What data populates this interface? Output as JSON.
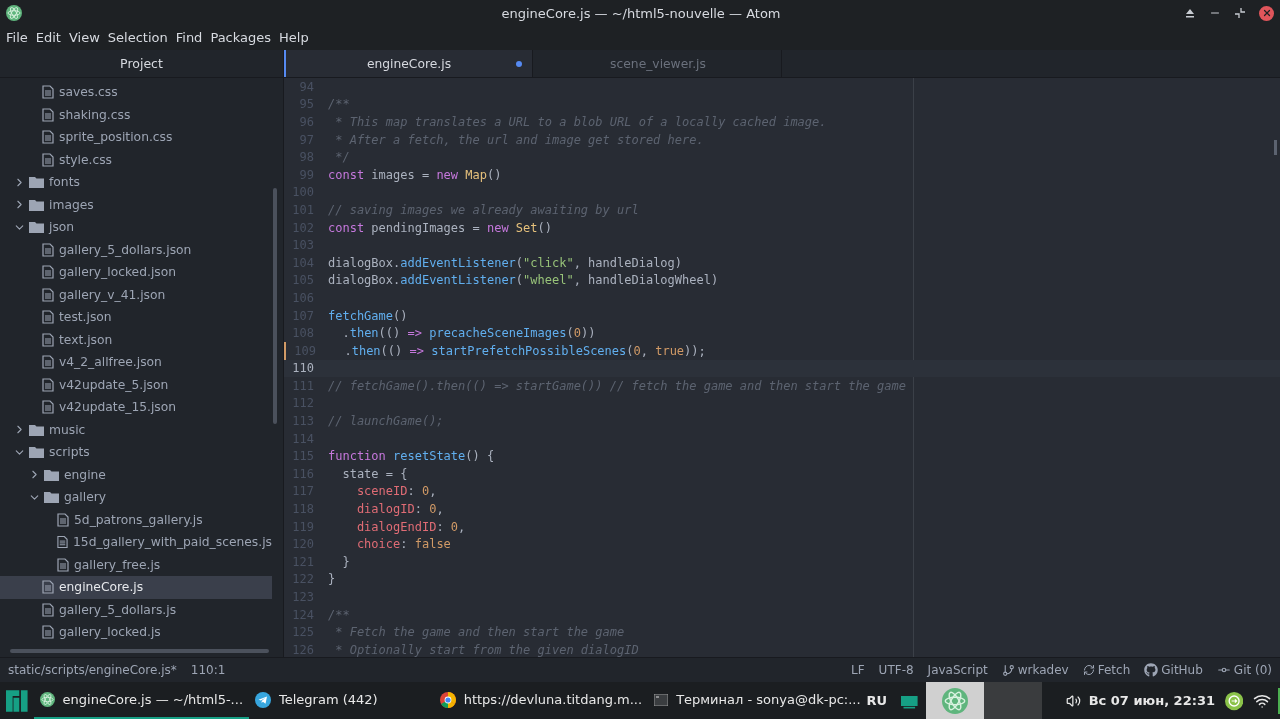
{
  "window": {
    "title": "engineCore.js — ~/html5-nouvelle — Atom"
  },
  "menu": [
    "File",
    "Edit",
    "View",
    "Selection",
    "Find",
    "Packages",
    "Help"
  ],
  "sidebar": {
    "title": "Project",
    "tree": [
      {
        "kind": "group",
        "children": [
          {
            "kind": "file",
            "label": "saves.css",
            "selected": false
          },
          {
            "kind": "file",
            "label": "shaking.css",
            "selected": false
          },
          {
            "kind": "file",
            "label": "sprite_position.css",
            "selected": false
          },
          {
            "kind": "file",
            "label": "style.css",
            "selected": false
          }
        ]
      },
      {
        "kind": "folder",
        "label": "fonts",
        "expanded": false,
        "selected": false
      },
      {
        "kind": "folder",
        "label": "images",
        "expanded": false,
        "selected": false
      },
      {
        "kind": "folder",
        "label": "json",
        "expanded": true,
        "selected": false,
        "children": [
          {
            "kind": "file",
            "label": "gallery_5_dollars.json",
            "selected": false
          },
          {
            "kind": "file",
            "label": "gallery_locked.json",
            "selected": false
          },
          {
            "kind": "file",
            "label": "gallery_v_41.json",
            "selected": false
          },
          {
            "kind": "file",
            "label": "test.json",
            "selected": false
          },
          {
            "kind": "file",
            "label": "text.json",
            "selected": false
          },
          {
            "kind": "file",
            "label": "v4_2_allfree.json",
            "selected": false
          },
          {
            "kind": "file",
            "label": "v42update_5.json",
            "selected": false
          },
          {
            "kind": "file",
            "label": "v42update_15.json",
            "selected": false
          }
        ]
      },
      {
        "kind": "folder",
        "label": "music",
        "expanded": false,
        "selected": false
      },
      {
        "kind": "folder",
        "label": "scripts",
        "expanded": true,
        "selected": false,
        "children": [
          {
            "kind": "folder",
            "label": "engine",
            "expanded": false,
            "selected": false
          },
          {
            "kind": "folder",
            "label": "gallery",
            "expanded": true,
            "selected": false,
            "children": [
              {
                "kind": "file",
                "label": "5d_patrons_gallery.js",
                "selected": false
              },
              {
                "kind": "file",
                "label": "15d_gallery_with_paid_scenes.js",
                "selected": false
              },
              {
                "kind": "file",
                "label": "gallery_free.js",
                "selected": false
              }
            ]
          },
          {
            "kind": "file",
            "label": "engineCore.js",
            "selected": true
          },
          {
            "kind": "file",
            "label": "gallery_5_dollars.js",
            "selected": false
          },
          {
            "kind": "file",
            "label": "gallery_locked.js",
            "selected": false
          }
        ]
      }
    ]
  },
  "tabs": [
    {
      "label": "engineCore.js",
      "selected": true,
      "modified": true
    },
    {
      "label": "scene_viewer.js",
      "selected": false,
      "modified": false
    }
  ],
  "editor": {
    "lines": [
      {
        "number": "94",
        "cursor": false,
        "modified": false
      },
      {
        "number": "95",
        "cursor": false,
        "modified": false,
        "tokens": [
          {
            "kind": "comment",
            "text": "/**"
          }
        ]
      },
      {
        "number": "96",
        "cursor": false,
        "modified": false,
        "tokens": [
          {
            "kind": "comment",
            "text": " * This map translates a URL to a blob URL of a locally cached image."
          }
        ]
      },
      {
        "number": "97",
        "cursor": false,
        "modified": false,
        "tokens": [
          {
            "kind": "comment",
            "text": " * After a fetch, the url and image get stored here."
          }
        ]
      },
      {
        "number": "98",
        "cursor": false,
        "modified": false,
        "tokens": [
          {
            "kind": "comment",
            "text": " */"
          }
        ]
      },
      {
        "number": "99",
        "cursor": false,
        "modified": false,
        "tokens": [
          {
            "kind": "keyword",
            "text": "const"
          },
          {
            "kind": "plain",
            "text": " images = "
          },
          {
            "kind": "keyword",
            "text": "new "
          },
          {
            "kind": "class",
            "text": "Map"
          },
          {
            "kind": "plain",
            "text": "()"
          }
        ]
      },
      {
        "number": "100",
        "cursor": false,
        "modified": false
      },
      {
        "number": "101",
        "cursor": false,
        "modified": false,
        "tokens": [
          {
            "kind": "comment",
            "text": "// saving images we already awaiting by url"
          }
        ]
      },
      {
        "number": "102",
        "cursor": false,
        "modified": false,
        "tokens": [
          {
            "kind": "keyword",
            "text": "const"
          },
          {
            "kind": "plain",
            "text": " pendingImages = "
          },
          {
            "kind": "keyword",
            "text": "new "
          },
          {
            "kind": "class",
            "text": "Set"
          },
          {
            "kind": "plain",
            "text": "()"
          }
        ]
      },
      {
        "number": "103",
        "cursor": false,
        "modified": false
      },
      {
        "number": "104",
        "cursor": false,
        "modified": false,
        "tokens": [
          {
            "kind": "plain",
            "text": "dialogBox."
          },
          {
            "kind": "function",
            "text": "addEventListener"
          },
          {
            "kind": "plain",
            "text": "("
          },
          {
            "kind": "string",
            "text": "\"click\""
          },
          {
            "kind": "plain",
            "text": ", handleDialog)"
          }
        ]
      },
      {
        "number": "105",
        "cursor": false,
        "modified": false,
        "tokens": [
          {
            "kind": "plain",
            "text": "dialogBox."
          },
          {
            "kind": "function",
            "text": "addEventListener"
          },
          {
            "kind": "plain",
            "text": "("
          },
          {
            "kind": "string",
            "text": "\"wheel\""
          },
          {
            "kind": "plain",
            "text": ", handleDialogWheel)"
          }
        ]
      },
      {
        "number": "106",
        "cursor": false,
        "modified": false
      },
      {
        "number": "107",
        "cursor": false,
        "modified": false,
        "tokens": [
          {
            "kind": "function",
            "text": "fetchGame"
          },
          {
            "kind": "plain",
            "text": "()"
          }
        ]
      },
      {
        "number": "108",
        "cursor": false,
        "modified": false,
        "tokens": [
          {
            "kind": "plain",
            "text": "  ."
          },
          {
            "kind": "function",
            "text": "then"
          },
          {
            "kind": "plain",
            "text": "(() "
          },
          {
            "kind": "keyword",
            "text": "=> "
          },
          {
            "kind": "function",
            "text": "precacheSceneImages"
          },
          {
            "kind": "plain",
            "text": "("
          },
          {
            "kind": "number",
            "text": "0"
          },
          {
            "kind": "plain",
            "text": "))"
          }
        ]
      },
      {
        "number": "109",
        "cursor": false,
        "modified": true,
        "tokens": [
          {
            "kind": "plain",
            "text": "  ."
          },
          {
            "kind": "function",
            "text": "then"
          },
          {
            "kind": "plain",
            "text": "(() "
          },
          {
            "kind": "keyword",
            "text": "=> "
          },
          {
            "kind": "function",
            "text": "startPrefetchPossibleScenes"
          },
          {
            "kind": "plain",
            "text": "("
          },
          {
            "kind": "number",
            "text": "0"
          },
          {
            "kind": "plain",
            "text": ", "
          },
          {
            "kind": "number",
            "text": "true"
          },
          {
            "kind": "plain",
            "text": "));"
          }
        ]
      },
      {
        "number": "110",
        "cursor": true,
        "modified": false
      },
      {
        "number": "111",
        "cursor": false,
        "modified": false,
        "tokens": [
          {
            "kind": "comment",
            "text": "// fetchGame().then(() => startGame()) // fetch the game and then start the game"
          }
        ]
      },
      {
        "number": "112",
        "cursor": false,
        "modified": false
      },
      {
        "number": "113",
        "cursor": false,
        "modified": false,
        "tokens": [
          {
            "kind": "comment",
            "text": "// launchGame();"
          }
        ]
      },
      {
        "number": "114",
        "cursor": false,
        "modified": false
      },
      {
        "number": "115",
        "cursor": false,
        "modified": false,
        "tokens": [
          {
            "kind": "keyword",
            "text": "function "
          },
          {
            "kind": "function",
            "text": "resetState"
          },
          {
            "kind": "plain",
            "text": "() {"
          }
        ]
      },
      {
        "number": "116",
        "cursor": false,
        "modified": false,
        "tokens": [
          {
            "kind": "plain",
            "text": "  state = {"
          }
        ]
      },
      {
        "number": "117",
        "cursor": false,
        "modified": false,
        "tokens": [
          {
            "kind": "property",
            "text": "    sceneID"
          },
          {
            "kind": "plain",
            "text": ": "
          },
          {
            "kind": "number",
            "text": "0"
          },
          {
            "kind": "plain",
            "text": ","
          }
        ]
      },
      {
        "number": "118",
        "cursor": false,
        "modified": false,
        "tokens": [
          {
            "kind": "property",
            "text": "    dialogID"
          },
          {
            "kind": "plain",
            "text": ": "
          },
          {
            "kind": "number",
            "text": "0"
          },
          {
            "kind": "plain",
            "text": ","
          }
        ]
      },
      {
        "number": "119",
        "cursor": false,
        "modified": false,
        "tokens": [
          {
            "kind": "property",
            "text": "    dialogEndID"
          },
          {
            "kind": "plain",
            "text": ": "
          },
          {
            "kind": "number",
            "text": "0"
          },
          {
            "kind": "plain",
            "text": ","
          }
        ]
      },
      {
        "number": "120",
        "cursor": false,
        "modified": false,
        "tokens": [
          {
            "kind": "property",
            "text": "    choice"
          },
          {
            "kind": "plain",
            "text": ": "
          },
          {
            "kind": "number",
            "text": "false"
          }
        ]
      },
      {
        "number": "121",
        "cursor": false,
        "modified": false,
        "tokens": [
          {
            "kind": "plain",
            "text": "  }"
          }
        ]
      },
      {
        "number": "122",
        "cursor": false,
        "modified": false,
        "tokens": [
          {
            "kind": "plain",
            "text": "}"
          }
        ]
      },
      {
        "number": "123",
        "cursor": false,
        "modified": false
      },
      {
        "number": "124",
        "cursor": false,
        "modified": false,
        "tokens": [
          {
            "kind": "comment",
            "text": "/**"
          }
        ]
      },
      {
        "number": "125",
        "cursor": false,
        "modified": false,
        "tokens": [
          {
            "kind": "comment",
            "text": " * Fetch the game and then start the game"
          }
        ]
      },
      {
        "number": "126",
        "cursor": false,
        "modified": false,
        "tokens": [
          {
            "kind": "comment",
            "text": " * Optionally start from the given dialogID"
          }
        ]
      }
    ]
  },
  "status_bar": {
    "file": "static/scripts/engineCore.js*",
    "position": "110:1",
    "line_ending": "LF",
    "encoding": "UTF-8",
    "grammar": "JavaScript",
    "branch": "wrkadev",
    "fetch": "Fetch",
    "github": "GitHub",
    "git": "Git (0)"
  },
  "taskbar": {
    "tasks": [
      {
        "kind": "atom",
        "label": "engineCore.js — ~/html5-...",
        "selected": true
      },
      {
        "kind": "telegram",
        "label": "Telegram (442)",
        "selected": false
      },
      {
        "kind": "browser",
        "label": "https://devluna.titdang.m...",
        "selected": false
      },
      {
        "kind": "terminal",
        "label": "Терминал - sonya@dk-pc:...",
        "selected": false
      }
    ],
    "keyboard_layout": "RU",
    "clock": "Вс 07 июн, 22:31"
  }
}
